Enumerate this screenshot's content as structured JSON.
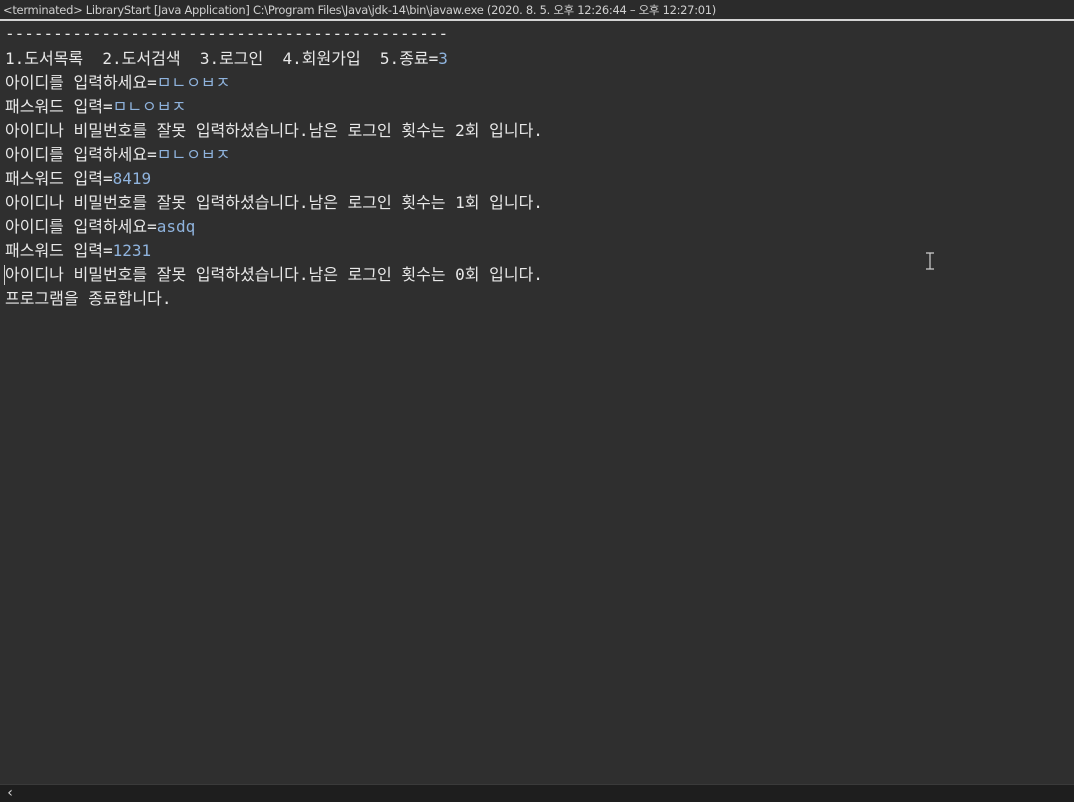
{
  "window": {
    "title": "<terminated> LibraryStart [Java Application] C:\\Program Files\\Java\\jdk-14\\bin\\javaw.exe  (2020. 8. 5. 오후 12:26:44 – 오후 12:27:01)"
  },
  "console": {
    "separator": "----------------------------------------------",
    "lines": [
      {
        "text": "1.도서목록  2.도서검색  3.로그인  4.회원가입  5.종료=",
        "input": "3"
      },
      {
        "text": "아이디를 입력하세요=",
        "input": "ㅁㄴㅇㅂㅈ"
      },
      {
        "text": "패스워드 입력=",
        "input": "ㅁㄴㅇㅂㅈ"
      },
      {
        "text": "아이디나 비밀번호를 잘못 입력하셨습니다.남은 로그인 횟수는 2회 입니다.",
        "input": ""
      },
      {
        "text": "아이디를 입력하세요=",
        "input": "ㅁㄴㅇㅂㅈ"
      },
      {
        "text": "패스워드 입력=",
        "input": "8419"
      },
      {
        "text": "아이디나 비밀번호를 잘못 입력하셨습니다.남은 로그인 횟수는 1회 입니다.",
        "input": ""
      },
      {
        "text": "아이디를 입력하세요=",
        "input": "asdq"
      },
      {
        "text": "패스워드 입력=",
        "input": "1231"
      },
      {
        "text": "아이디나 비밀번호를 잘못 입력하셨습니다.남은 로그인 횟수는 0회 입니다.",
        "input": ""
      },
      {
        "text": "프로그램을 종료합니다.",
        "input": ""
      }
    ]
  },
  "scrollbar": {
    "left_arrow_icon": "chevron-left-icon"
  },
  "colors": {
    "background": "#2f2f2f",
    "output_text": "#e8e8e8",
    "input_text": "#8fb3dd"
  }
}
